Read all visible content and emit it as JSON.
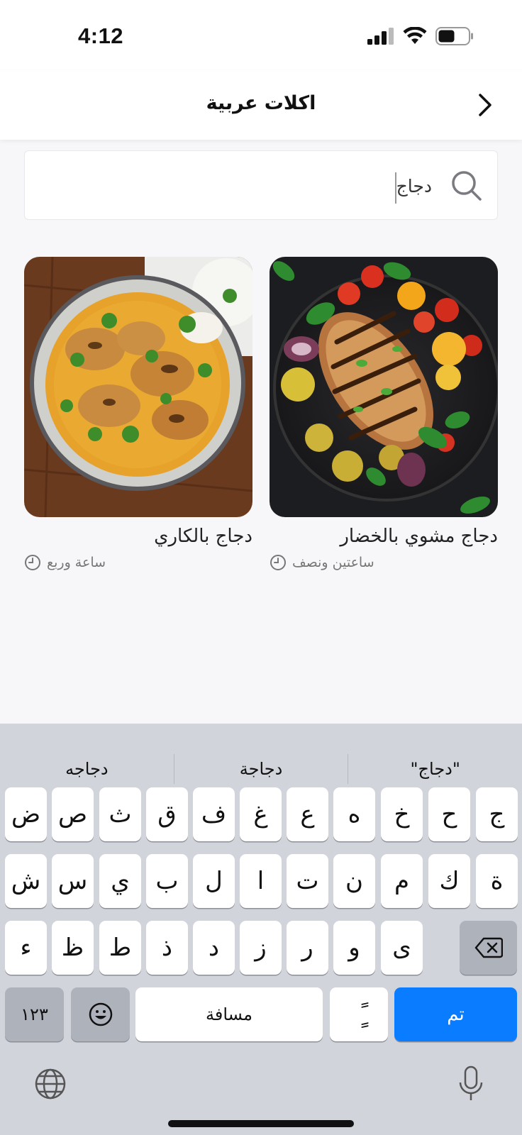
{
  "status_bar": {
    "time": "4:12"
  },
  "header": {
    "title": "اكلات عربية"
  },
  "search": {
    "value": "دجاج",
    "placeholder": ""
  },
  "recipes": [
    {
      "title": "دجاج مشوي بالخضار",
      "duration": "ساعتين ونصف"
    },
    {
      "title": "دجاج  بالكاري",
      "duration": "ساعة وربع"
    }
  ],
  "keyboard": {
    "suggestions": [
      "\"دجاج\"",
      "دجاجة",
      "دجاجه"
    ],
    "row1": [
      "ج",
      "ح",
      "خ",
      "ه",
      "ع",
      "غ",
      "ف",
      "ق",
      "ث",
      "ص",
      "ض"
    ],
    "row2": [
      "ة",
      "ك",
      "م",
      "ن",
      "ت",
      "ا",
      "ل",
      "ب",
      "ي",
      "س",
      "ش"
    ],
    "row3": [
      "ى",
      "و",
      "ر",
      "ز",
      "د",
      "ذ",
      "ط",
      "ظ",
      "ء"
    ],
    "numbers_label": "١٢٣",
    "space_label": "مسافة",
    "diacritic_label": "ًٍ",
    "done_label": "تم"
  },
  "colors": {
    "accent": "#0a7cff",
    "keyboard_bg": "#d1d4db"
  }
}
